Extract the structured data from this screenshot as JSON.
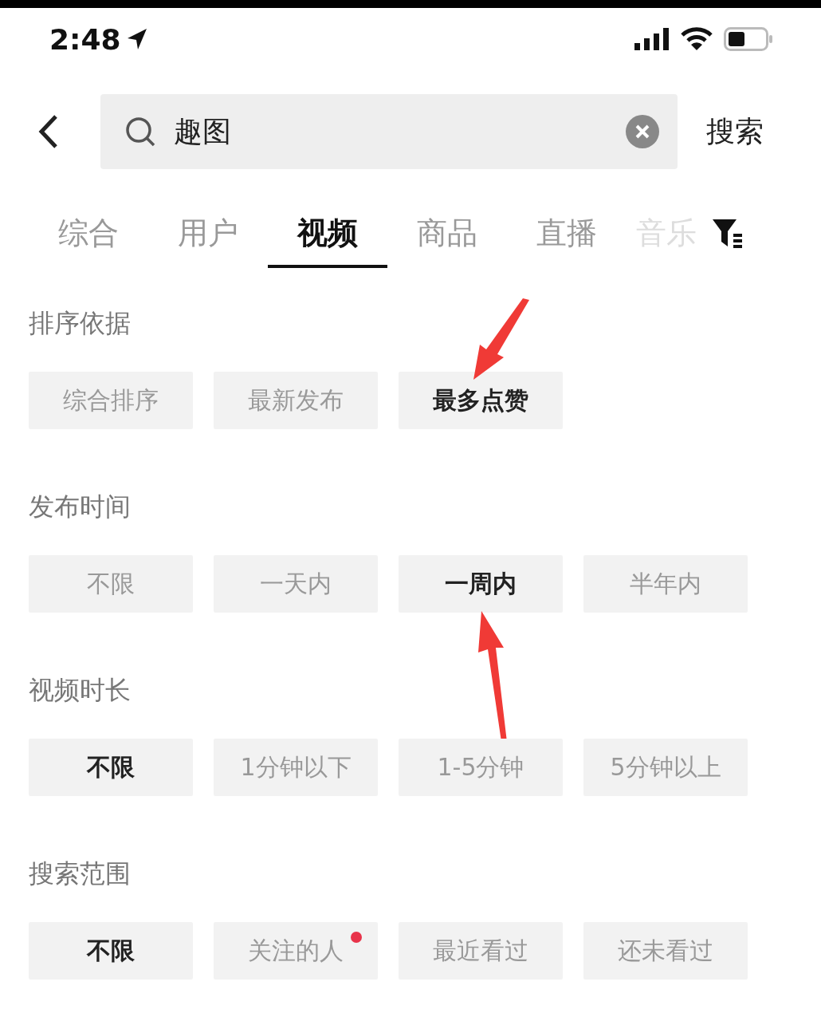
{
  "status_bar": {
    "time": "2:48"
  },
  "search": {
    "value": "趣图",
    "action": "搜索"
  },
  "tabs": [
    {
      "label": "综合",
      "selected": false
    },
    {
      "label": "用户",
      "selected": false
    },
    {
      "label": "视频",
      "selected": true
    },
    {
      "label": "商品",
      "selected": false
    },
    {
      "label": "直播",
      "selected": false
    },
    {
      "label": "音乐",
      "selected": false
    }
  ],
  "filters": [
    {
      "title": "排序依据",
      "options": [
        {
          "label": "综合排序",
          "selected": false
        },
        {
          "label": "最新发布",
          "selected": false
        },
        {
          "label": "最多点赞",
          "selected": true,
          "arrow": {
            "kind": "above"
          }
        }
      ]
    },
    {
      "title": "发布时间",
      "options": [
        {
          "label": "不限",
          "selected": false
        },
        {
          "label": "一天内",
          "selected": false
        },
        {
          "label": "一周内",
          "selected": true,
          "arrow": {
            "kind": "below"
          }
        },
        {
          "label": "半年内",
          "selected": false
        }
      ]
    },
    {
      "title": "视频时长",
      "options": [
        {
          "label": "不限",
          "selected": true
        },
        {
          "label": "1分钟以下",
          "selected": false
        },
        {
          "label": "1-5分钟",
          "selected": false
        },
        {
          "label": "5分钟以上",
          "selected": false
        }
      ]
    },
    {
      "title": "搜索范围",
      "options": [
        {
          "label": "不限",
          "selected": true
        },
        {
          "label": "关注的人",
          "selected": false,
          "dot": true
        },
        {
          "label": "最近看过",
          "selected": false
        },
        {
          "label": "还未看过",
          "selected": false
        }
      ]
    }
  ]
}
